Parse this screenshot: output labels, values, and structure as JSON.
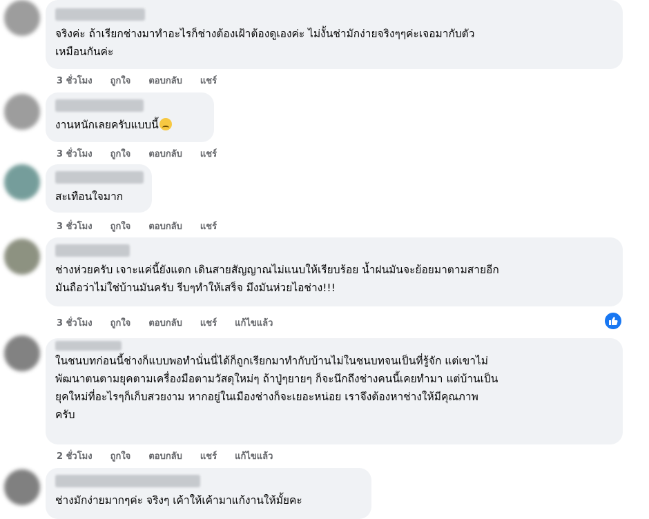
{
  "comments": [
    {
      "text": "จริงค่ะ ถ้าเรียกช่างมาทำอะไรก็ช่างต้องเฝ้าต้องดูเองค่ะ ไม่งั้นช่ามักง่ายจริงๆๆค่ะเจอมากับตัว\nเหมือนกันค่ะ",
      "time": "3 ชั่วโมง",
      "like": "ถูกใจ",
      "reply": "ตอบกลับ",
      "share": "แชร์"
    },
    {
      "text": "งานหนักเลยครับแบบนี้",
      "time": "3 ชั่วโมง",
      "like": "ถูกใจ",
      "reply": "ตอบกลับ",
      "share": "แชร์"
    },
    {
      "text": "สะเทือนใจมาก",
      "time": "3 ชั่วโมง",
      "like": "ถูกใจ",
      "reply": "ตอบกลับ",
      "share": "แชร์"
    },
    {
      "text": "ช่างห่วยครับ เจาะแค่นี้ยังแตก เดินสายสัญญาณไม่แนบให้เรียบร้อย น้ำฝนมันจะย้อยมาตามสายอีก\nมันถือว่าไม่ใช่บ้านมันครับ รีบๆทำให้เสร็จ มึงมันห่วยไอช่าง!!!",
      "time": "3 ชั่วโมง",
      "like": "ถูกใจ",
      "reply": "ตอบกลับ",
      "share": "แชร์",
      "edited": "แก้ไขแล้ว"
    },
    {
      "text": "ในชนบทก่อนนี้ช่างก็แบบพอทำนั่นนี่ได้ก็ถูกเรียกมาทำกับบ้านไม่ในชนบทจนเป็นที่รู้จัก แต่เขาไม่\nพัฒนาตนตามยุคตามเครื่องมือตามวัสดุใหม่ๆ ถ้าปู่ๆยายๆ ก็จะนึกถึงช่างคนนี้เคยทำมา แต่บ้านเป็น\nยุคใหม่ที่อะไรๆก็เก็บสวยงาม หากอยู่ในเมืองช่างก็จะเยอะหน่อย เราจึงต้องหาช่างให้มีคุณภาพ\nครับ",
      "time": "2 ชั่วโมง",
      "like": "ถูกใจ",
      "reply": "ตอบกลับ",
      "share": "แชร์",
      "edited": "แก้ไขแล้ว"
    },
    {
      "text": "ช่างมักง่ายมากๆค่ะ จริงๆ เค้าให้เค้ามาแก้งานให้มั้ยคะ"
    }
  ],
  "icons": {
    "reaction": "like-icon",
    "emoji": "sad-face-emoji-icon"
  },
  "colors": {
    "bubble": "#f0f2f5",
    "action_text": "#65676b",
    "like_blue": "#1877f2"
  }
}
